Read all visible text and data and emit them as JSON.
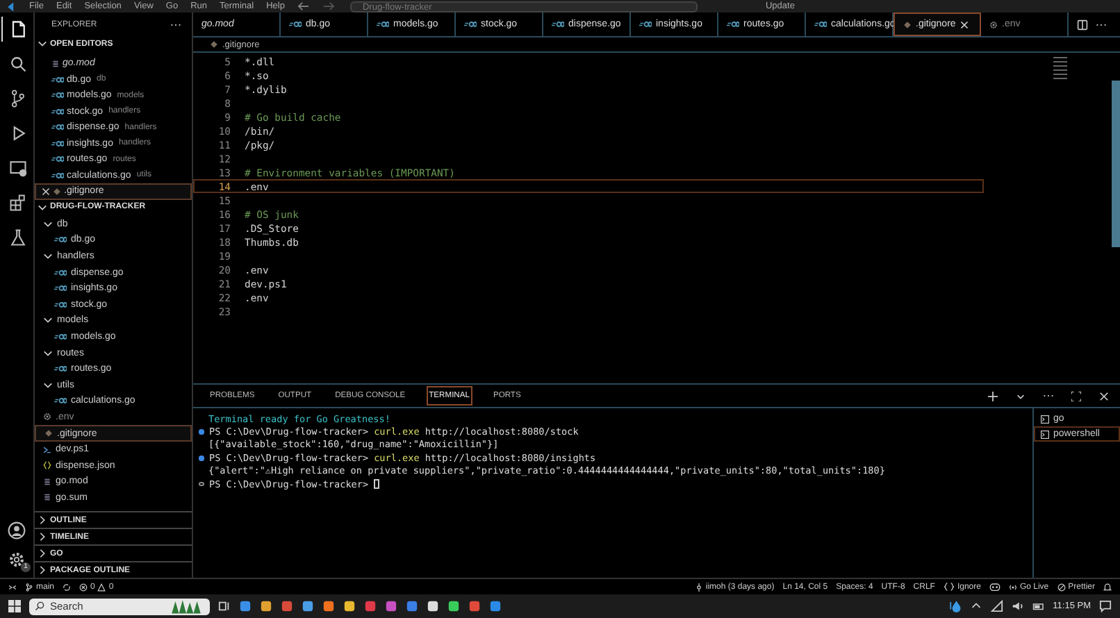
{
  "menu": [
    "File",
    "Edit",
    "Selection",
    "View",
    "Go",
    "Run",
    "Terminal",
    "Help"
  ],
  "command_center": {
    "value": "Drug-flow-tracker"
  },
  "update_label": "Update",
  "activity_bar": [
    {
      "kind": "files",
      "selected": true
    },
    {
      "kind": "search",
      "selected": false
    },
    {
      "kind": "source-control",
      "selected": false
    },
    {
      "kind": "run",
      "selected": false
    },
    {
      "kind": "remote",
      "selected": false
    },
    {
      "kind": "extensions",
      "selected": false
    },
    {
      "kind": "testing",
      "selected": false
    }
  ],
  "settings_badge": "1",
  "sidebar": {
    "title": "EXPLORER",
    "open_editors": {
      "title": "OPEN EDITORS",
      "expanded": true,
      "items": [
        {
          "name": "go.mod",
          "kind": "mod",
          "preview": true,
          "selected": false
        },
        {
          "name": "db.go",
          "detail": "db",
          "kind": "go",
          "preview": false,
          "selected": false
        },
        {
          "name": "models.go",
          "detail": "models",
          "kind": "go",
          "preview": false,
          "selected": false
        },
        {
          "name": "stock.go",
          "detail": "handlers",
          "kind": "go",
          "preview": false,
          "selected": false
        },
        {
          "name": "dispense.go",
          "detail": "handlers",
          "kind": "go",
          "preview": false,
          "selected": false
        },
        {
          "name": "insights.go",
          "detail": "handlers",
          "kind": "go",
          "preview": false,
          "selected": false
        },
        {
          "name": "routes.go",
          "detail": "routes",
          "kind": "go",
          "preview": false,
          "selected": false
        },
        {
          "name": "calculations.go",
          "detail": "utils",
          "kind": "go",
          "preview": false,
          "selected": false
        },
        {
          "name": ".gitignore",
          "kind": "ignore",
          "preview": false,
          "selected": true
        }
      ]
    },
    "project": {
      "title": "DRUG-FLOW-TRACKER",
      "expanded": true,
      "children": [
        {
          "name": "db",
          "kind": "folder",
          "expanded": true,
          "selected": false,
          "children": [
            {
              "name": "db.go",
              "kind": "go",
              "selected": false
            }
          ]
        },
        {
          "name": "handlers",
          "kind": "folder",
          "expanded": true,
          "selected": false,
          "children": [
            {
              "name": "dispense.go",
              "kind": "go",
              "selected": false
            },
            {
              "name": "insights.go",
              "kind": "go",
              "selected": false
            },
            {
              "name": "stock.go",
              "kind": "go",
              "selected": false
            }
          ]
        },
        {
          "name": "models",
          "kind": "folder",
          "expanded": true,
          "selected": false,
          "children": [
            {
              "name": "models.go",
              "kind": "go",
              "selected": false
            }
          ]
        },
        {
          "name": "routes",
          "kind": "folder",
          "expanded": true,
          "selected": false,
          "children": [
            {
              "name": "routes.go",
              "kind": "go",
              "selected": false
            }
          ]
        },
        {
          "name": "utils",
          "kind": "folder",
          "expanded": true,
          "selected": false,
          "children": [
            {
              "name": "calculations.go",
              "kind": "go",
              "selected": false
            }
          ]
        },
        {
          "name": ".env",
          "kind": "env",
          "selected": false
        },
        {
          "name": ".gitignore",
          "kind": "ignore",
          "selected": true
        },
        {
          "name": "dev.ps1",
          "kind": "ps1",
          "selected": false
        },
        {
          "name": "dispense.json",
          "kind": "json",
          "selected": false
        },
        {
          "name": "go.mod",
          "kind": "mod",
          "selected": false
        },
        {
          "name": "go.sum",
          "kind": "mod",
          "selected": false
        }
      ]
    },
    "collapsed_sections": [
      {
        "title": "OUTLINE",
        "expanded": false
      },
      {
        "title": "TIMELINE",
        "expanded": false
      },
      {
        "title": "GO",
        "expanded": false
      },
      {
        "title": "PACKAGE OUTLINE",
        "expanded": false
      }
    ]
  },
  "tabs": [
    {
      "label": "go.mod",
      "kind": "plain",
      "preview": true,
      "selected": false
    },
    {
      "label": "db.go",
      "kind": "go",
      "preview": false,
      "selected": false
    },
    {
      "label": "models.go",
      "kind": "go",
      "preview": false,
      "selected": false
    },
    {
      "label": "stock.go",
      "kind": "go",
      "preview": false,
      "selected": false
    },
    {
      "label": "dispense.go",
      "kind": "go",
      "preview": false,
      "selected": false
    },
    {
      "label": "insights.go",
      "kind": "go",
      "preview": false,
      "selected": false
    },
    {
      "label": "routes.go",
      "kind": "go",
      "preview": false,
      "selected": false
    },
    {
      "label": "calculations.go",
      "kind": "go",
      "preview": false,
      "selected": false
    },
    {
      "label": ".gitignore",
      "kind": "ignore",
      "preview": false,
      "selected": true
    },
    {
      "label": ".env",
      "kind": "env",
      "preview": false,
      "selected": false
    }
  ],
  "breadcrumb": ".gitignore",
  "code_lines": [
    {
      "number": "5",
      "text": "*.dll",
      "kind": "plain",
      "selected": false
    },
    {
      "number": "6",
      "text": "*.so",
      "kind": "plain",
      "selected": false
    },
    {
      "number": "7",
      "text": "*.dylib",
      "kind": "plain",
      "selected": false
    },
    {
      "number": "8",
      "selected": false
    },
    {
      "number": "9",
      "text": "# Go build cache",
      "kind": "comment",
      "selected": false
    },
    {
      "number": "10",
      "text": "/bin/",
      "kind": "plain",
      "selected": false
    },
    {
      "number": "11",
      "text": "/pkg/",
      "kind": "plain",
      "selected": false
    },
    {
      "number": "12",
      "selected": false
    },
    {
      "number": "13",
      "text": "# Environment variables (IMPORTANT)",
      "kind": "comment",
      "selected": false
    },
    {
      "number": "14",
      "text": ".env",
      "kind": "plain",
      "selected": true
    },
    {
      "number": "15",
      "selected": false
    },
    {
      "number": "16",
      "text": "# OS junk",
      "kind": "comment",
      "selected": false
    },
    {
      "number": "17",
      "text": ".DS_Store",
      "kind": "plain",
      "selected": false
    },
    {
      "number": "18",
      "text": "Thumbs.db",
      "kind": "plain",
      "selected": false
    },
    {
      "number": "19",
      "selected": false
    },
    {
      "number": "20",
      "text": ".env",
      "kind": "plain",
      "selected": false
    },
    {
      "number": "21",
      "text": "dev.ps1",
      "kind": "plain",
      "selected": false
    },
    {
      "number": "22",
      "text": ".env",
      "kind": "plain",
      "selected": false
    },
    {
      "number": "23",
      "selected": false
    }
  ],
  "panel_tabs": [
    {
      "label": "PROBLEMS",
      "selected": false
    },
    {
      "label": "OUTPUT",
      "selected": false
    },
    {
      "label": "DEBUG CONSOLE",
      "selected": false
    },
    {
      "label": "TERMINAL",
      "selected": true
    },
    {
      "label": "PORTS",
      "selected": false
    }
  ],
  "terminal_lines": [
    {
      "kind": "banner",
      "text": "Terminal ready for Go Greatness!"
    },
    {
      "kind": "command",
      "succeeded": true,
      "prompt": "PS C:\\Dev\\Drug-flow-tracker>",
      "command": "curl.exe",
      "argument": "http://localhost:8080/stock"
    },
    {
      "kind": "output",
      "text": "[{\"available_stock\":160,\"drug_name\":\"Amoxicillin\"}]"
    },
    {
      "kind": "command",
      "succeeded": true,
      "prompt": "PS C:\\Dev\\Drug-flow-tracker>",
      "command": "curl.exe",
      "argument": "http://localhost:8080/insights"
    },
    {
      "kind": "output",
      "text": "{\"alert\":\"⚠High reliance on private suppliers\",\"private_ratio\":0.4444444444444444,\"private_units\":80,\"total_units\":180}"
    },
    {
      "kind": "command",
      "succeeded": false,
      "prompt": "PS C:\\Dev\\Drug-flow-tracker>"
    }
  ],
  "terminal_sessions": [
    {
      "label": "go",
      "selected": false
    },
    {
      "label": "powershell",
      "selected": true
    }
  ],
  "status_bar": {
    "branch": "main",
    "errors": "0",
    "warnings": "0",
    "right": [
      {
        "kind": "blame",
        "text": "iimoh (3 days ago)"
      },
      {
        "kind": "text",
        "text": "Ln 14, Col 5"
      },
      {
        "kind": "text",
        "text": "Spaces: 4"
      },
      {
        "kind": "text",
        "text": "UTF-8"
      },
      {
        "kind": "text",
        "text": "CRLF"
      },
      {
        "kind": "language",
        "text": "Ignore"
      },
      {
        "kind": "copilot"
      },
      {
        "kind": "live",
        "text": "Go Live"
      },
      {
        "kind": "prettier",
        "text": "Prettier"
      },
      {
        "kind": "bell"
      }
    ]
  },
  "taskbar": {
    "search_placeholder": "Search",
    "time": "11:15 PM"
  }
}
